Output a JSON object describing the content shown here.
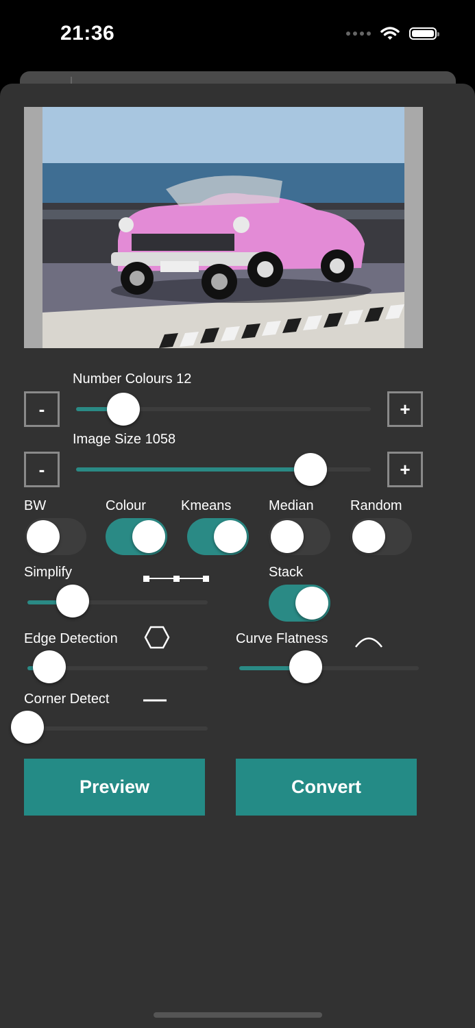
{
  "status_bar": {
    "time": "21:36"
  },
  "preview_image": {
    "description_icon": "pink-convertible-photo"
  },
  "sliders": {
    "number_colours": {
      "label": "Number Colours 12",
      "value": 12,
      "fraction": 0.16,
      "minus": "-",
      "plus": "+"
    },
    "image_size": {
      "label": "Image Size 1058",
      "value": 1058,
      "fraction": 0.795,
      "minus": "-",
      "plus": "+"
    },
    "simplify": {
      "label": "Simplify",
      "fraction": 0.25,
      "icon": "polyline-icon"
    },
    "edge_detection": {
      "label": "Edge Detection",
      "fraction": 0.12,
      "icon": "hexagon-icon"
    },
    "curve_flatness": {
      "label": "Curve Flatness",
      "fraction": 0.37,
      "icon": "arc-icon"
    },
    "corner_detect": {
      "label": "Corner Detect",
      "fraction": 0.0,
      "icon": "dash-icon"
    }
  },
  "toggles": {
    "bw": {
      "label": "BW",
      "on": false
    },
    "colour": {
      "label": "Colour",
      "on": true
    },
    "kmeans": {
      "label": "Kmeans",
      "on": true
    },
    "median": {
      "label": "Median",
      "on": false
    },
    "random": {
      "label": "Random",
      "on": false
    },
    "stack": {
      "label": "Stack",
      "on": true
    }
  },
  "buttons": {
    "preview": "Preview",
    "convert": "Convert"
  },
  "colors": {
    "accent": "#248b86",
    "sheet": "#323232",
    "track": "#3d3d3d"
  }
}
